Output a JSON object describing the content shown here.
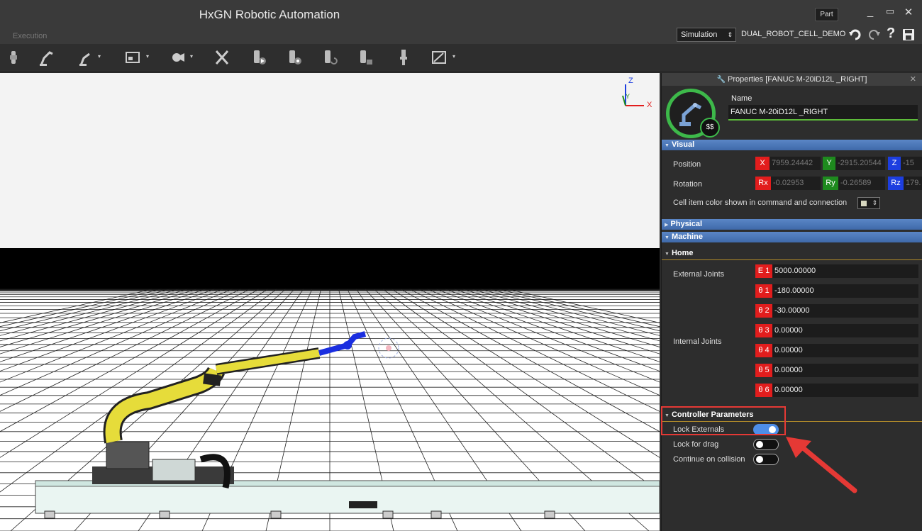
{
  "app": {
    "title": "HxGN Robotic Automation",
    "section_label": "Execution",
    "part_button": "Part",
    "minimize": "_",
    "restore": "▭",
    "close": "✕",
    "simulation_select": "Simulation",
    "project_name": "DUAL_ROBOT_CELL_DEMO",
    "undo_icon": "undo-icon",
    "redo_icon": "redo-icon",
    "help_label": "?",
    "save_icon": "save-icon"
  },
  "toolbar": {
    "tools": [
      {
        "name": "robot-tool-icon"
      },
      {
        "name": "robot-arm-icon"
      },
      {
        "name": "robot-arm-dropdown-icon"
      },
      {
        "name": "view-dropdown-icon"
      },
      {
        "name": "camera-dropdown-icon"
      },
      {
        "name": "remove-robot-icon"
      },
      {
        "name": "gripper-play-icon"
      },
      {
        "name": "gripper-record-icon"
      },
      {
        "name": "gripper-refresh-icon"
      },
      {
        "name": "gripper-lock-icon"
      },
      {
        "name": "tcp-icon"
      },
      {
        "name": "selection-dropdown-icon"
      }
    ]
  },
  "viewport": {
    "axes": {
      "x": "X",
      "y": "Y",
      "z": "Z"
    }
  },
  "properties": {
    "title": "Properties [FANUC M-20iD12L _RIGHT]",
    "close": "✕",
    "avatar_badge": "$$",
    "name_label": "Name",
    "name_value": "FANUC M-20iD12L _RIGHT",
    "sections": {
      "visual": "Visual",
      "physical": "Physical",
      "machine": "Machine"
    },
    "visual": {
      "position_label": "Position",
      "rotation_label": "Rotation",
      "x_tag": "X",
      "x_value": "7959.24442",
      "y_tag": "Y",
      "y_value": "-2915.20544",
      "z_tag": "Z",
      "z_value": "-15",
      "rx_tag": "Rx",
      "rx_value": "-0.02953",
      "ry_tag": "Ry",
      "ry_value": "-0.26589",
      "rz_tag": "Rz",
      "rz_value": "179.",
      "color_label": "Cell item color shown in command and connection"
    },
    "home": {
      "title": "Home",
      "external_label": "External Joints",
      "internal_label": "Internal Joints",
      "joints": [
        {
          "tag": "E 1",
          "value": "5000.00000"
        },
        {
          "tag": "θ 1",
          "value": "-180.00000"
        },
        {
          "tag": "θ 2",
          "value": "-30.00000"
        },
        {
          "tag": "θ 3",
          "value": "0.00000"
        },
        {
          "tag": "θ 4",
          "value": "0.00000"
        },
        {
          "tag": "θ 5",
          "value": "0.00000"
        },
        {
          "tag": "θ 6",
          "value": "0.00000"
        }
      ]
    },
    "controller": {
      "title": "Controller Parameters",
      "lock_externals": "Lock Externals",
      "lock_externals_on": true,
      "lock_for_drag": "Lock for drag",
      "lock_for_drag_on": false,
      "continue_on_collision": "Continue on collision",
      "continue_on_collision_on": false
    }
  },
  "colors": {
    "accent_blue": "#4e8ee8",
    "section_blue": "#4f78b8",
    "ring_green": "#3db94a",
    "tag_red": "#e21d1d",
    "robot_yellow": "#e6dc3a",
    "annotation_red": "#e53935"
  }
}
